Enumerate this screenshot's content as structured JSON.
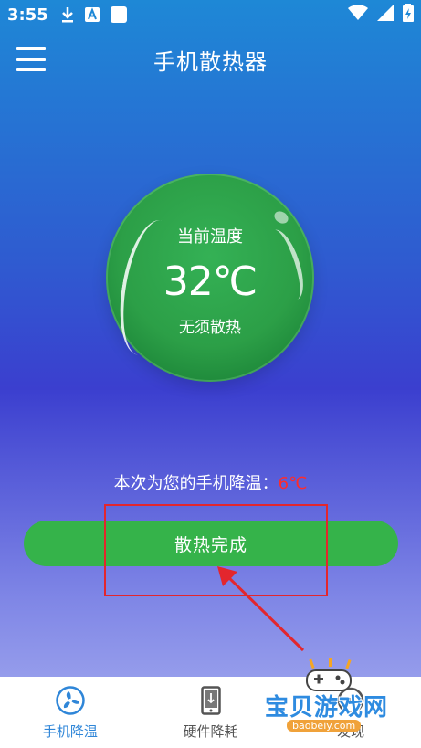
{
  "status_bar": {
    "time": "3:55",
    "icons": [
      "download-icon",
      "a-icon",
      "square-icon",
      "wifi-icon",
      "signal-icon",
      "battery-icon"
    ]
  },
  "app_bar": {
    "title": "手机散热器"
  },
  "temperature": {
    "label": "当前温度",
    "value": "32℃",
    "status": "无须散热"
  },
  "cooling": {
    "message": "本次为您的手机降温：",
    "value": "6℃"
  },
  "action_button": {
    "label": "散热完成"
  },
  "bottom_nav": {
    "items": [
      {
        "label": "手机降温",
        "icon": "fan-icon",
        "active": true
      },
      {
        "label": "硬件降耗",
        "icon": "phone-icon",
        "active": false
      },
      {
        "label": "发现",
        "icon": "compass-icon",
        "active": false
      }
    ]
  },
  "watermark": {
    "text": "宝贝游戏网",
    "url": "baobeiy.com"
  },
  "colors": {
    "ball_green": "#2c9f47",
    "button_green": "#35b34a",
    "accent_blue": "#2f86d8",
    "alert_red": "#ff2b2b"
  }
}
